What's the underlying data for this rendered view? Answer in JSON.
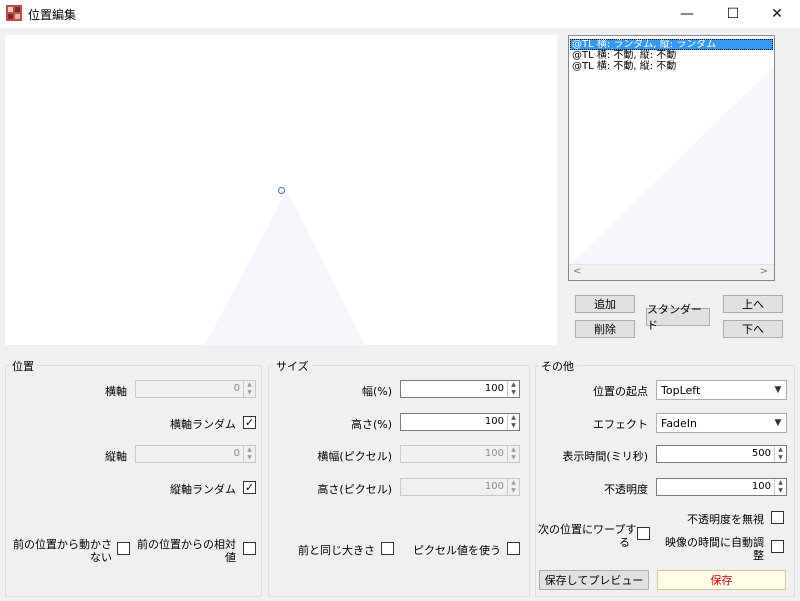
{
  "window": {
    "title": "位置編集",
    "minimize": "—",
    "maximize": "☐",
    "close": "✕"
  },
  "list": {
    "items": [
      {
        "text": "@TL 横: ランダム, 縦: ランダム",
        "selected": true
      },
      {
        "text": "@TL 横: 不動, 縦: 不動",
        "selected": false
      },
      {
        "text": "@TL 横: 不動, 縦: 不動",
        "selected": false
      }
    ],
    "scroll_left": "<",
    "scroll_right": ">"
  },
  "list_buttons": {
    "add": "追加",
    "delete": "削除",
    "standard": "スタンダード",
    "up": "上へ",
    "down": "下へ"
  },
  "position": {
    "title": "位置",
    "horizontal_label": "横軸",
    "horizontal_value": "0",
    "horizontal_random_label": "横軸ランダム",
    "horizontal_random_check": "✓",
    "vertical_label": "縦軸",
    "vertical_value": "0",
    "vertical_random_label": "縦軸ランダム",
    "vertical_random_check": "✓",
    "no_move_line1": "前の位置から動かさ",
    "no_move_line2": "ない",
    "relative_line1": "前の位置からの相対",
    "relative_line2": "値"
  },
  "size": {
    "title": "サイズ",
    "width_pct_label": "幅(%)",
    "width_pct_value": "100",
    "height_pct_label": "高さ(%)",
    "height_pct_value": "100",
    "width_px_label": "横幅(ピクセル)",
    "width_px_value": "100",
    "height_px_label": "高さ(ピクセル)",
    "height_px_value": "100",
    "same_size_label": "前と同じ大きさ",
    "use_pixel_label": "ピクセル値を使う"
  },
  "other": {
    "title": "その他",
    "origin_label": "位置の起点",
    "origin_value": "TopLeft",
    "effect_label": "エフェクト",
    "effect_value": "FadeIn",
    "display_time_label": "表示時間(ミリ秒)",
    "display_time_value": "500",
    "opacity_label": "不透明度",
    "opacity_value": "100",
    "ignore_opacity_label": "不透明度を無視",
    "warp_line1": "次の位置にワープす",
    "warp_line2": "る",
    "auto_adjust_line1": "映像の時間に自動調",
    "auto_adjust_line2": "整"
  },
  "footer": {
    "save_preview": "保存してプレビュー",
    "save": "保存"
  },
  "colors": {
    "accent": "#3399ff",
    "save_text": "#e60012",
    "save_bg": "#fffde6"
  }
}
